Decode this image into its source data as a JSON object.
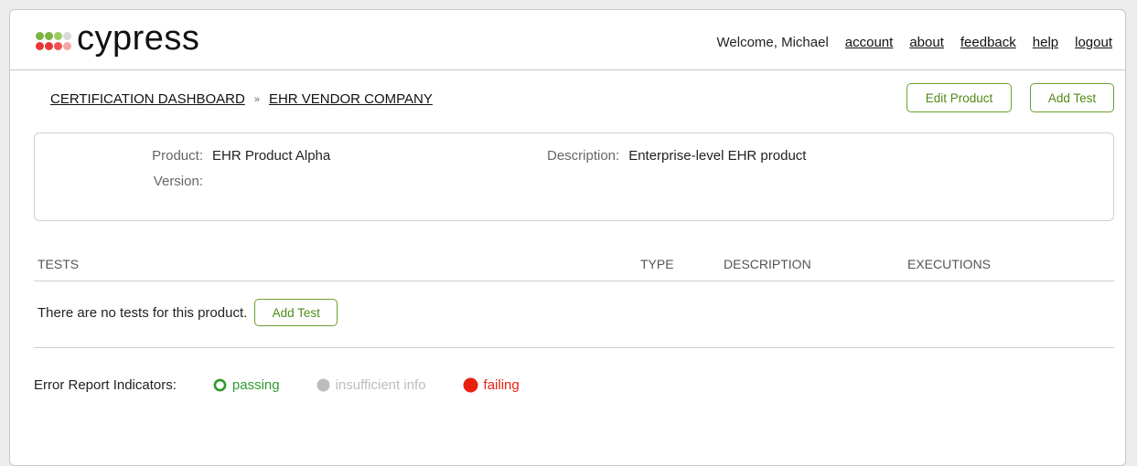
{
  "brand": {
    "name": "cypress",
    "dot_colors": [
      "#7cb342",
      "#7cb342",
      "#9ccc65",
      "#d9d9d9",
      "#e53935",
      "#e53935",
      "#ef5350",
      "#f4a6a6"
    ]
  },
  "topnav": {
    "welcome": "Welcome, Michael",
    "links": [
      "account",
      "about",
      "feedback",
      "help",
      "logout"
    ]
  },
  "breadcrumb": {
    "items": [
      "CERTIFICATION DASHBOARD",
      "EHR VENDOR COMPANY"
    ],
    "separator": "»"
  },
  "actions": {
    "edit_product": "Edit Product",
    "add_test": "Add Test"
  },
  "product": {
    "product_label": "Product:",
    "product_value": "EHR Product Alpha",
    "version_label": "Version:",
    "version_value": "",
    "description_label": "Description:",
    "description_value": "Enterprise-level EHR product"
  },
  "tests_table": {
    "columns": [
      "TESTS",
      "TYPE",
      "DESCRIPTION",
      "EXECUTIONS"
    ],
    "empty_message": "There are no tests for this product.",
    "add_test": "Add Test"
  },
  "legend": {
    "title": "Error Report Indicators:",
    "items": [
      {
        "label": "passing",
        "icon": "passing-ring-icon",
        "color": "#2e9a2e"
      },
      {
        "label": "insufficient info",
        "icon": "insufficient-dot-icon",
        "color": "#bdbdbd"
      },
      {
        "label": "failing",
        "icon": "failing-dot-icon",
        "color": "#e8200f"
      }
    ]
  }
}
